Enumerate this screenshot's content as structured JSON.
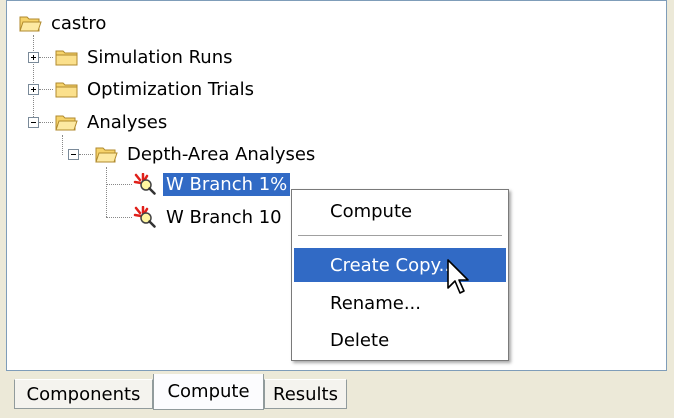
{
  "tree": {
    "root": {
      "label": "castro",
      "icon": "folder-open-icon"
    },
    "items": [
      {
        "label": "Simulation Runs",
        "icon": "folder-icon",
        "expanded": false
      },
      {
        "label": "Optimization Trials",
        "icon": "folder-icon",
        "expanded": false
      },
      {
        "label": "Analyses",
        "icon": "folder-open-icon",
        "expanded": true
      },
      {
        "label": "Depth-Area Analyses",
        "icon": "folder-open-icon",
        "expanded": true
      },
      {
        "label": "W Branch 1%",
        "icon": "depth-area-analysis-icon",
        "selected": true
      },
      {
        "label": "W Branch 10",
        "icon": "depth-area-analysis-icon",
        "selected": false
      }
    ]
  },
  "context_menu": {
    "items": [
      {
        "label": "Compute"
      },
      {
        "label": "Create Copy..."
      },
      {
        "label": "Rename..."
      },
      {
        "label": "Delete"
      }
    ],
    "highlighted": "Create Copy..."
  },
  "tabs": [
    {
      "label": "Components",
      "active": false
    },
    {
      "label": "Compute",
      "active": true
    },
    {
      "label": "Results",
      "active": false
    }
  ],
  "colors": {
    "selection": "#316ac5",
    "folder": "#f6d36a",
    "panel_border": "#7f9db9",
    "window_bg": "#ece9d8"
  }
}
